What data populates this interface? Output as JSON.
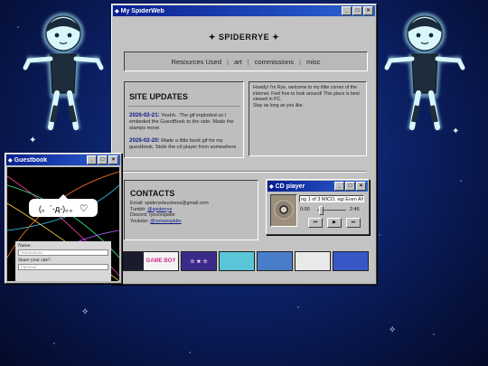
{
  "main_window": {
    "title": "My SpiderWeb",
    "site_title": "SPIDERRYE",
    "nav": [
      "Resources Used",
      "art",
      "commissions",
      "misc"
    ]
  },
  "updates": {
    "heading": "SITE UPDATES",
    "items": [
      {
        "date": "2026-02-21:",
        "text": "Yeahh.. The gif imploded so I embeded the GuestBook to the side. Made the stamps move."
      },
      {
        "date": "2026-02-20:",
        "text": "Made a little book gif for my guestbook. Stole the cd player from somewhere"
      }
    ]
  },
  "welcome": {
    "text": "Howdy! I'm Rye, welcome to my little corner of the internet. Feel free to look around! This place is best viewed in PC.",
    "sub": "Stay as long as you like."
  },
  "contacts": {
    "heading": "CONTACTS",
    "email": "Email: spideryebusiness@gmail.com",
    "tumblr_label": "Tumblr: ",
    "tumblr_handle": "@spiderrye",
    "discord": "Discord: ryesorspider",
    "youtube_label": "Youtube: ",
    "youtube_handle": "@ryesorspider"
  },
  "cd_player": {
    "title": "CD player",
    "track": "ng 1 of 3 MICO, egi  Even AN(",
    "time_start": "0:00",
    "time_end": "2:46",
    "buttons": [
      "⏮",
      "▶",
      "⏭"
    ]
  },
  "stamps": [
    {
      "label": "",
      "bg": "#1b1b2e",
      "fg": "#fff"
    },
    {
      "label": "GAME BOY",
      "bg": "#f4f4f4",
      "fg": "#d12b8e"
    },
    {
      "label": "☆ ★ ☆",
      "bg": "#3a2b8a",
      "fg": "#ffd6f5"
    },
    {
      "label": "",
      "bg": "#58c6d6",
      "fg": "#fff"
    },
    {
      "label": "",
      "bg": "#4a7dc9",
      "fg": "#fff"
    },
    {
      "label": "",
      "bg": "#e9e9e9",
      "fg": "#e34b8e"
    },
    {
      "label": "",
      "bg": "#3857c7",
      "fg": "#a9f"
    }
  ],
  "guestbook": {
    "title": "Guestbook",
    "kaomoji": "(。´-д-)。。 ♡",
    "name_label": "Name:",
    "name_placeholder": "Anonymous",
    "site_label": "Share your site?:",
    "site_placeholder": "Optional"
  },
  "colors": {
    "titlebar": "#0a1f8f",
    "window": "#c0c0c0",
    "link": "#0c1a88",
    "bg": "#0c2167"
  }
}
